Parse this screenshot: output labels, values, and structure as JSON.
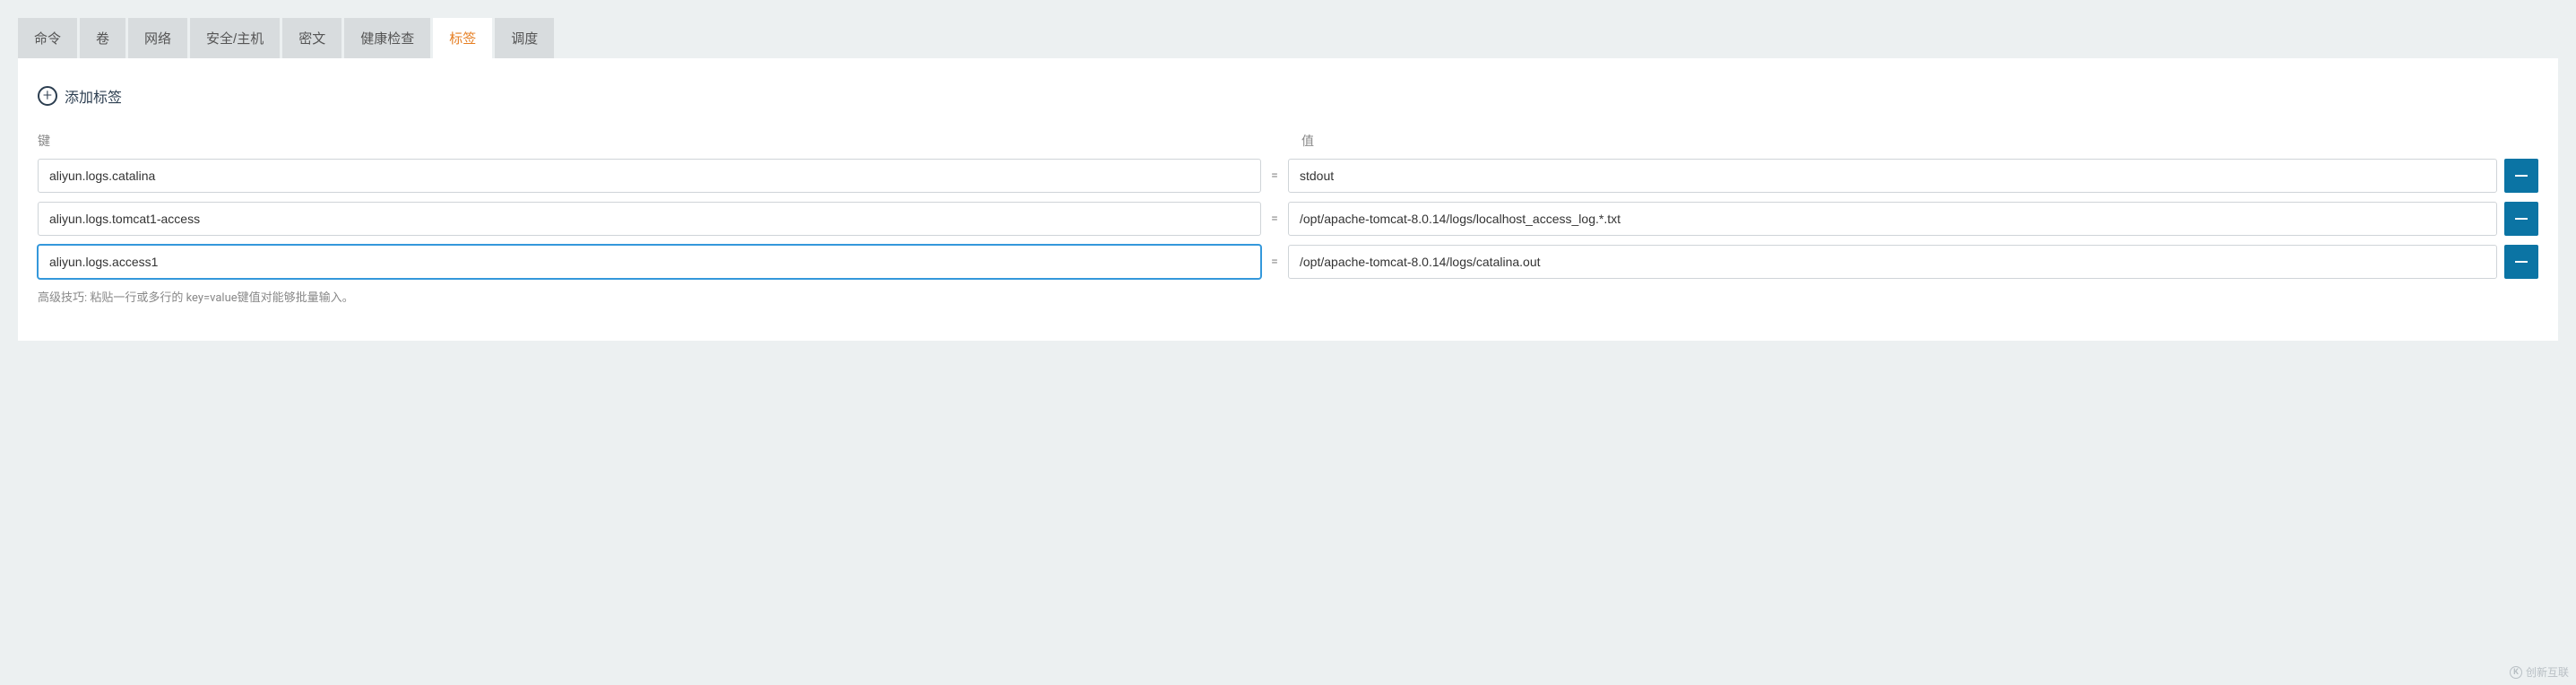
{
  "tabs": [
    {
      "label": "命令",
      "active": false
    },
    {
      "label": "卷",
      "active": false
    },
    {
      "label": "网络",
      "active": false
    },
    {
      "label": "安全/主机",
      "active": false
    },
    {
      "label": "密文",
      "active": false
    },
    {
      "label": "健康检查",
      "active": false
    },
    {
      "label": "标签",
      "active": true
    },
    {
      "label": "调度",
      "active": false
    }
  ],
  "add_label_text": "添加标签",
  "headers": {
    "key": "键",
    "value": "值"
  },
  "rows": [
    {
      "key": "aliyun.logs.catalina",
      "value": "stdout",
      "focused": false
    },
    {
      "key": "aliyun.logs.tomcat1-access",
      "value": "/opt/apache-tomcat-8.0.14/logs/localhost_access_log.*.txt",
      "focused": false
    },
    {
      "key": "aliyun.logs.access1",
      "value": "/opt/apache-tomcat-8.0.14/logs/catalina.out",
      "focused": true
    }
  ],
  "hint": "高级技巧: 粘贴一行或多行的 key=value键值对能够批量输入。",
  "equals": "=",
  "watermark": "创新互联"
}
